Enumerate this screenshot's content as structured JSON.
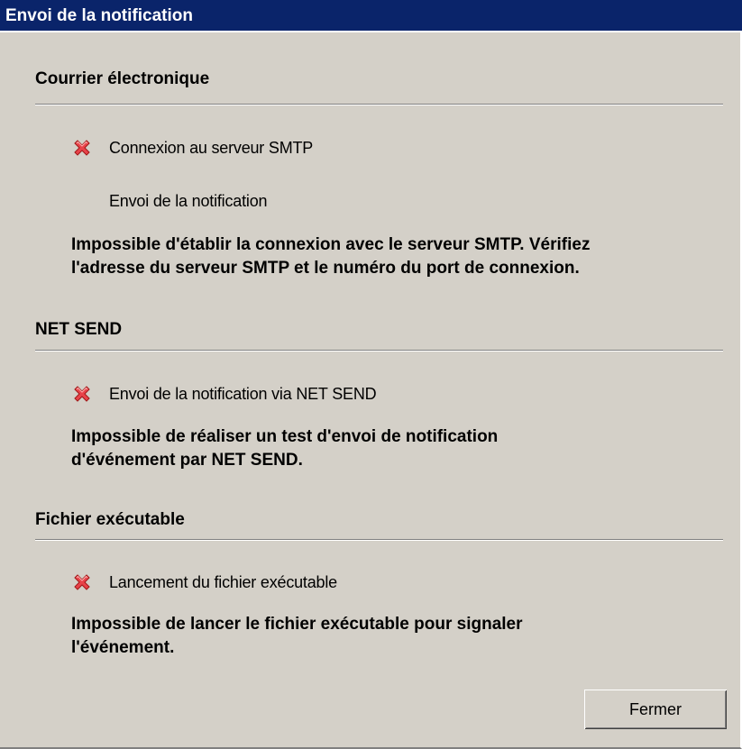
{
  "window": {
    "title": "Envoi de la notification"
  },
  "sections": [
    {
      "title": "Courrier électronique",
      "steps": [
        {
          "label": "Connexion au serveur SMTP",
          "icon": "error-x-icon"
        },
        {
          "label": "Envoi de la notification",
          "icon": ""
        }
      ],
      "message": "Impossible d'établir la connexion avec le serveur SMTP. Vérifiez\nl'adresse du serveur SMTP et le numéro du port de connexion."
    },
    {
      "title": "NET SEND",
      "steps": [
        {
          "label": "Envoi de la notification via NET SEND",
          "icon": "error-x-icon"
        }
      ],
      "message": "Impossible de réaliser un test d'envoi de notification\nd'événement par NET SEND."
    },
    {
      "title": "Fichier exécutable",
      "steps": [
        {
          "label": "Lancement du fichier exécutable",
          "icon": "error-x-icon"
        }
      ],
      "message": "Impossible de lancer le fichier exécutable pour signaler\nl'événement."
    }
  ],
  "buttons": {
    "close_label": "Fermer"
  },
  "colors": {
    "titlebar": "#0a246a",
    "dialog_bg": "#d4d0c8",
    "error_icon": "#e8434a"
  }
}
